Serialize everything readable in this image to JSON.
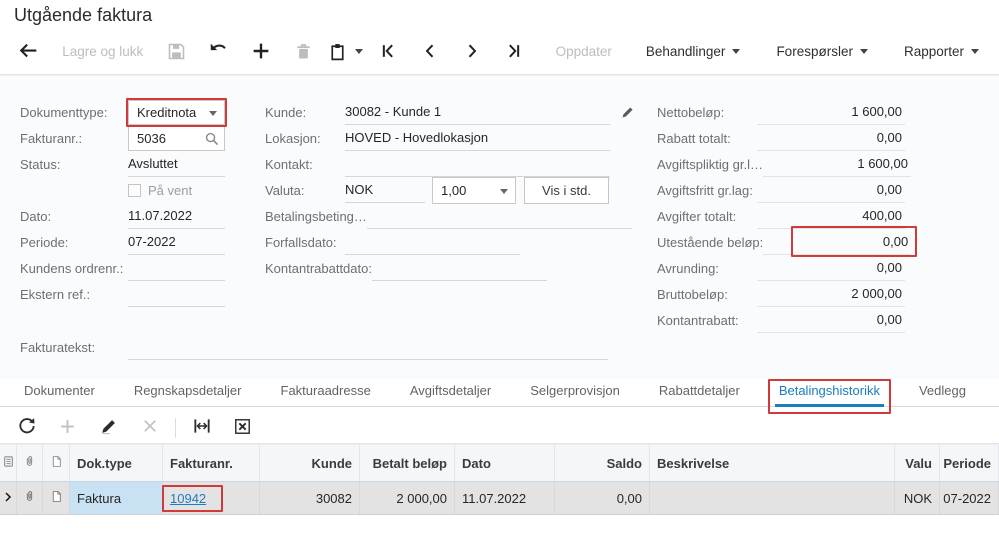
{
  "title": "Utgående faktura",
  "toolbar": {
    "save_close": "Lagre og lukk",
    "refresh": "Oppdater",
    "menus": [
      "Behandlinger",
      "Forespørsler",
      "Rapporter"
    ]
  },
  "form": {
    "left": [
      {
        "name": "dokumenttype",
        "label": "Dokumenttype:",
        "value": "Kreditnota",
        "widget": "select",
        "annotated": true
      },
      {
        "name": "fakturanr",
        "label": "Fakturanr.:",
        "value": "5036",
        "widget": "lookup"
      },
      {
        "name": "status",
        "label": "Status:",
        "value": "Avsluttet",
        "widget": "readonly"
      },
      {
        "name": "pa-vent",
        "label": "",
        "value": "På vent",
        "widget": "checkbox",
        "checked": false
      },
      {
        "name": "dato",
        "label": "Dato:",
        "value": "11.07.2022",
        "widget": "text"
      },
      {
        "name": "periode",
        "label": "Periode:",
        "value": "07-2022",
        "widget": "text"
      },
      {
        "name": "kundens-ordrenr",
        "label": "Kundens ordrenr.:",
        "value": "",
        "widget": "text"
      },
      {
        "name": "ekstern-ref",
        "label": "Ekstern ref.:",
        "value": "",
        "widget": "text"
      }
    ],
    "fakturatekst": {
      "label": "Fakturatekst:",
      "value": ""
    },
    "middle_a": [
      {
        "name": "kunde",
        "label": "Kunde:",
        "value": "30082 - Kunde 1",
        "widget": "text",
        "edit_icon": true
      },
      {
        "name": "lokasjon",
        "label": "Lokasjon:",
        "value": "HOVED - Hovedlokasjon",
        "widget": "text"
      },
      {
        "name": "kontakt",
        "label": "Kontakt:",
        "value": "",
        "widget": "text"
      }
    ],
    "valuta": {
      "label": "Valuta:",
      "currency": "NOK",
      "rate": "1,00",
      "button": "Vis i std."
    },
    "middle_b": [
      {
        "name": "betalingsbetingelser",
        "label": "Betalingsbeting…",
        "value": "",
        "widget": "text"
      },
      {
        "name": "forfallsdato",
        "label": "Forfallsdato:",
        "value": "",
        "widget": "short"
      },
      {
        "name": "kontantrabattdato",
        "label": "Kontantrabattdato:",
        "value": "",
        "widget": "short"
      }
    ],
    "right": [
      {
        "name": "nettobelop",
        "label": "Nettobeløp:",
        "value": "1 600,00"
      },
      {
        "name": "rabatt-totalt",
        "label": "Rabatt totalt:",
        "value": "0,00"
      },
      {
        "name": "avgiftspliktig-grunnlag",
        "label": "Avgiftspliktig gr.l…",
        "value": "1 600,00"
      },
      {
        "name": "avgiftsfritt-grunnlag",
        "label": "Avgiftsfritt gr.lag:",
        "value": "0,00"
      },
      {
        "name": "avgifter-totalt",
        "label": "Avgifter totalt:",
        "value": "400,00"
      },
      {
        "name": "utestaende-belop",
        "label": "Utestående beløp:",
        "value": "0,00",
        "annotated": true
      },
      {
        "name": "avrunding",
        "label": "Avrunding:",
        "value": "0,00"
      },
      {
        "name": "bruttobelop",
        "label": "Bruttobeløp:",
        "value": "2 000,00"
      },
      {
        "name": "kontantrabatt",
        "label": "Kontantrabatt:",
        "value": "0,00"
      }
    ]
  },
  "tabs": [
    {
      "label": "Dokumenter"
    },
    {
      "label": "Regnskapsdetaljer"
    },
    {
      "label": "Fakturaadresse"
    },
    {
      "label": "Avgiftsdetaljer"
    },
    {
      "label": "Selgerprovisjon"
    },
    {
      "label": "Rabattdetaljer"
    },
    {
      "label": "Betalingshistorikk",
      "active": true,
      "annotated": true
    },
    {
      "label": "Vedlegg"
    }
  ],
  "grid": {
    "column_labels": {
      "dok_type": "Dok.type",
      "fakturanr": "Fakturanr.",
      "kunde": "Kunde",
      "betalt_belop": "Betalt beløp",
      "dato": "Dato",
      "saldo": "Saldo",
      "beskrivelse": "Beskrivelse",
      "valuta": "Valu",
      "periode": "Periode"
    },
    "rows": [
      {
        "dok_type": "Faktura",
        "fakturanr": "10942",
        "kunde": "30082",
        "betalt_belop": "2 000,00",
        "dato": "11.07.2022",
        "saldo": "0,00",
        "beskrivelse": "",
        "valuta": "NOK",
        "periode": "07-2022",
        "selected": true,
        "fakturanr_annotated": true
      }
    ]
  },
  "colors": {
    "accent_blue": "#1a7dc0",
    "annotation_red": "#cf3b3b",
    "selected_row": "#e3e3e3",
    "active_cell": "#c9e2f3",
    "header_bg": "#f5f6f8"
  }
}
